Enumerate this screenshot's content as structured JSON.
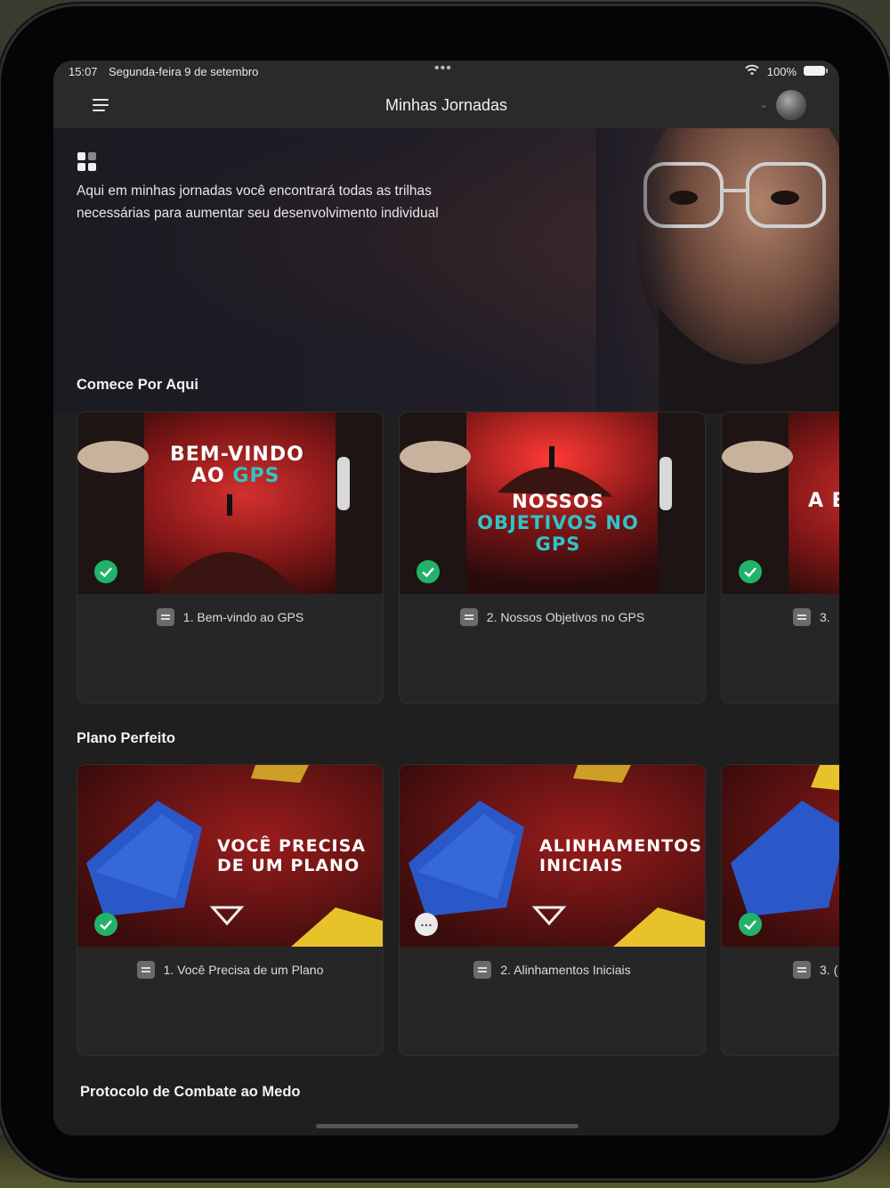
{
  "status_bar": {
    "time": "15:07",
    "date": "Segunda-feira 9 de setembro",
    "dots": "•••",
    "battery": "100%"
  },
  "nav": {
    "title": "Minhas Jornadas"
  },
  "hero": {
    "text": "Aqui em minhas jornadas você encontrará todas as trilhas necessárias para aumentar seu desenvolvimento individual"
  },
  "sections": [
    {
      "title": "Comece Por Aqui",
      "cards": [
        {
          "thumb_line1": "BEM-VINDO",
          "thumb_line2_a": "AO ",
          "thumb_line2_b": "GPS",
          "label": "1. Bem-vindo ao GPS",
          "status": "done"
        },
        {
          "thumb_line1": "NOSSOS",
          "thumb_line2_a": "",
          "thumb_line2_b": "OBJETIVOS NO GPS",
          "label": "2. Nossos Objetivos no GPS",
          "status": "done"
        },
        {
          "thumb_line1": "A E",
          "thumb_line2_a": "",
          "thumb_line2_b": "",
          "label": "3.",
          "status": "done"
        }
      ]
    },
    {
      "title": "Plano Perfeito",
      "cards": [
        {
          "thumb_line1": "VOCÊ PRECISA",
          "thumb_line2_a": "DE UM PLANO",
          "thumb_line2_b": "",
          "label": "1. Você Precisa de um Plano",
          "status": "done"
        },
        {
          "thumb_line1": "ALINHAMENTOS",
          "thumb_line2_a": "INICIAIS",
          "thumb_line2_b": "",
          "label": "2. Alinhamentos Iniciais",
          "status": "in-progress"
        },
        {
          "thumb_line1": "",
          "thumb_line2_a": "",
          "thumb_line2_b": "",
          "label": "3. (",
          "status": "done"
        }
      ]
    },
    {
      "title": "Protocolo de Combate ao Medo",
      "cards": []
    }
  ],
  "icons": {
    "menu": "hamburger-icon",
    "apps": "grid-icon",
    "document": "document-icon",
    "check": "check-circle-icon",
    "pending": "ellipsis-circle-icon",
    "wifi": "wifi-icon",
    "battery": "battery-icon"
  },
  "colors": {
    "accent_teal": "#34c2c8",
    "check_green": "#22b36a",
    "card_bg": "#262626",
    "screen_bg": "#1f1f1f"
  }
}
